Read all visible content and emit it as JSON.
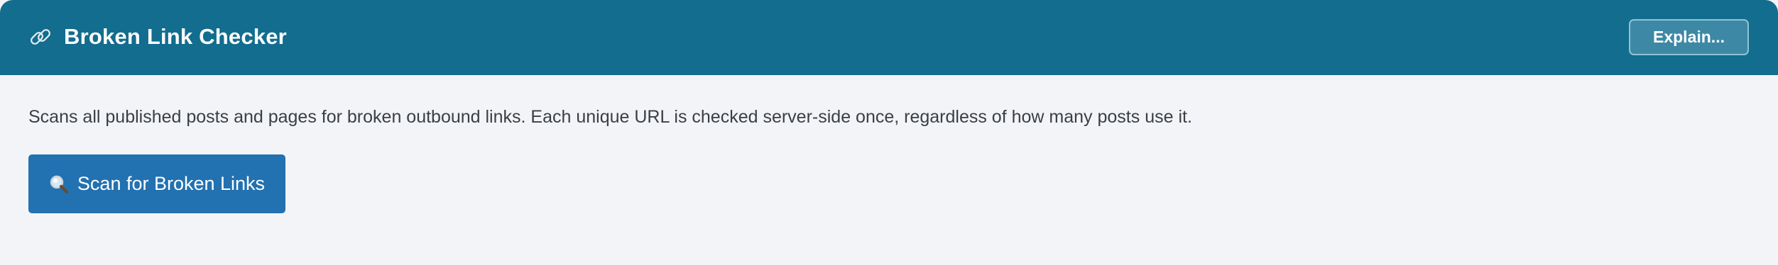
{
  "header": {
    "title": "Broken Link Checker",
    "icon": "link-icon",
    "explain_label": "Explain..."
  },
  "main": {
    "description": "Scans all published posts and pages for broken outbound links. Each unique URL is checked server-side once, regardless of how many posts use it.",
    "scan_button": {
      "icon": "magnifier-icon",
      "label": "Scan for Broken Links"
    }
  },
  "colors": {
    "header_bg": "#126d8e",
    "panel_bg": "#f3f4f7",
    "primary_button": "#2271b1"
  }
}
